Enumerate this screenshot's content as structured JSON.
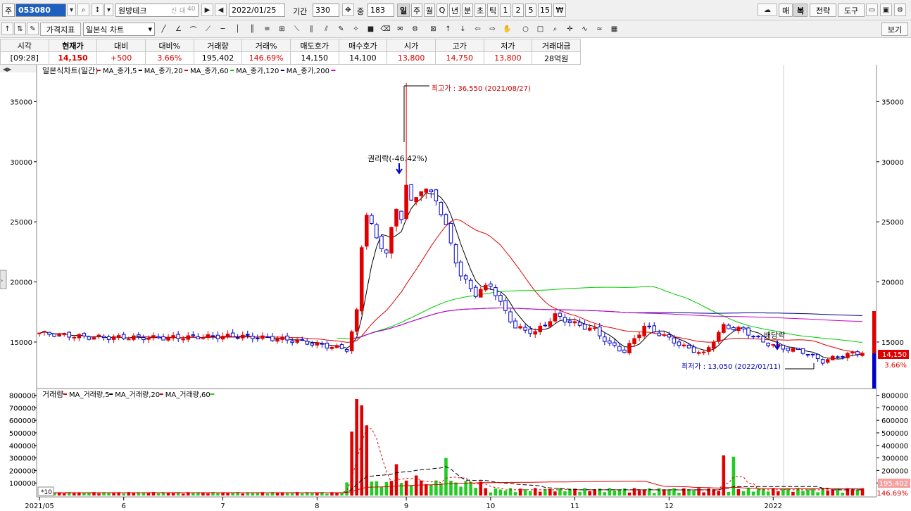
{
  "toolbar": {
    "market_btn": "주",
    "code": "053080",
    "stock_name": "원방테크",
    "date": "2022/01/25",
    "period_label": "기간",
    "period_value": "330",
    "overlap_label": "중",
    "overlap_value": "183",
    "tabs": [
      "일",
      "주",
      "월",
      "Q",
      "년",
      "분",
      "초",
      "틱",
      "1",
      "2",
      "5",
      "15",
      "₩"
    ],
    "right_buttons": [
      "매",
      "복",
      "전략",
      "도구"
    ],
    "indicator_btn": "가격지표",
    "chart_type": "일본식 차트",
    "view_btn": "보기",
    "badges": [
      "신",
      "대",
      "40"
    ]
  },
  "quote": {
    "headers": [
      "시각",
      "현재가",
      "대비",
      "대비%",
      "거래량",
      "거래%",
      "매도호가",
      "매수호가",
      "시가",
      "고가",
      "저가",
      "거래대금"
    ],
    "values": [
      "[09:28]",
      "14,150",
      "+500",
      "3.66%",
      "195,402",
      "146.69%",
      "14,150",
      "14,100",
      "13,800",
      "14,750",
      "13,800",
      "28억원"
    ]
  },
  "chart": {
    "price_title": "일본식차트(일간)",
    "price_legend": [
      {
        "label": "MA_종가,5",
        "color": "#e00000"
      },
      {
        "label": "MA_종가,20",
        "color": "#000000"
      },
      {
        "label": "MA_종가,60",
        "color": "#e00000"
      },
      {
        "label": "MA_종가,120",
        "color": "#00cc00"
      },
      {
        "label": "MA_종가,200",
        "color": "#00008b"
      }
    ],
    "volume_title": "거래량",
    "volume_legend": [
      {
        "label": "MA_거래량,5",
        "color": "#e00000"
      },
      {
        "label": "MA_거래량,20",
        "color": "#000000"
      },
      {
        "label": "MA_거래량,60",
        "color": "#e00000"
      }
    ],
    "annotations": {
      "high": "최고가 : 36,550 (2021/08/27)",
      "low": "최저가 : 13,050 (2022/01/11)",
      "rights": "권리락(-46.42%)",
      "dividend": "배당락"
    },
    "last_price_tag": "14,150",
    "last_change_tag": "3.66%",
    "last_volume_tag": "195,402",
    "last_volume_pct_tag": "146.69%",
    "volume_unit": "*10"
  },
  "chart_data": {
    "type": "candlestick",
    "title": "일본식차트(일간)",
    "price_axis": {
      "ticks": [
        15000,
        20000,
        25000,
        30000,
        35000
      ],
      "range": [
        11600,
        37600
      ]
    },
    "volume_axis": {
      "ticks": [
        100000,
        200000,
        300000,
        400000,
        500000,
        600000,
        700000,
        800000
      ],
      "range": [
        0,
        820000
      ]
    },
    "x_labels": [
      "2021/05",
      "6",
      "7",
      "8",
      "9",
      "10",
      "11",
      "12",
      "2022"
    ],
    "x_label_days": [
      0,
      17,
      37,
      56,
      74,
      91,
      108,
      127,
      148
    ],
    "days_total": 166,
    "key_points": [
      {
        "day": 0,
        "close": 15750
      },
      {
        "day": 10,
        "close": 15400
      },
      {
        "day": 25,
        "close": 15350
      },
      {
        "day": 40,
        "close": 15500
      },
      {
        "day": 50,
        "close": 15200
      },
      {
        "day": 62,
        "close": 14400
      },
      {
        "day": 63,
        "close": 15800
      },
      {
        "day": 64,
        "close": 17500
      },
      {
        "day": 65,
        "close": 23000
      },
      {
        "day": 66,
        "close": 25800
      },
      {
        "day": 68,
        "close": 23500
      },
      {
        "day": 70,
        "close": 22500
      },
      {
        "day": 72,
        "close": 26000
      },
      {
        "day": 73,
        "close": 25500
      },
      {
        "day": 74,
        "close": 28000
      },
      {
        "day": 75,
        "close": 26500
      },
      {
        "day": 77,
        "close": 27800
      },
      {
        "day": 80,
        "close": 27000
      },
      {
        "day": 82,
        "close": 24500
      },
      {
        "day": 85,
        "close": 20500
      },
      {
        "day": 88,
        "close": 19000
      },
      {
        "day": 91,
        "close": 19800
      },
      {
        "day": 93,
        "close": 18200
      },
      {
        "day": 96,
        "close": 16200
      },
      {
        "day": 100,
        "close": 15800
      },
      {
        "day": 104,
        "close": 17200
      },
      {
        "day": 108,
        "close": 16500
      },
      {
        "day": 112,
        "close": 16000
      },
      {
        "day": 115,
        "close": 14800
      },
      {
        "day": 118,
        "close": 14200
      },
      {
        "day": 122,
        "close": 16300
      },
      {
        "day": 126,
        "close": 15500
      },
      {
        "day": 130,
        "close": 14600
      },
      {
        "day": 134,
        "close": 14000
      },
      {
        "day": 138,
        "close": 16300
      },
      {
        "day": 142,
        "close": 16000
      },
      {
        "day": 146,
        "close": 15000
      },
      {
        "day": 150,
        "close": 14500
      },
      {
        "day": 154,
        "close": 14200
      },
      {
        "day": 158,
        "close": 13400
      },
      {
        "day": 162,
        "close": 13900
      },
      {
        "day": 166,
        "close": 14150
      }
    ],
    "high": {
      "day": 74,
      "value": 36550,
      "date": "2021/08/27"
    },
    "low": {
      "day": 158,
      "value": 13050,
      "date": "2022/01/11"
    },
    "volume_spikes": [
      {
        "day": 63,
        "value": 510000
      },
      {
        "day": 64,
        "value": 770000
      },
      {
        "day": 65,
        "value": 720000
      },
      {
        "day": 66,
        "value": 560000
      },
      {
        "day": 72,
        "value": 250000
      },
      {
        "day": 76,
        "value": 160000
      },
      {
        "day": 82,
        "value": 300000
      },
      {
        "day": 138,
        "value": 320000
      },
      {
        "day": 140,
        "value": 310000
      }
    ],
    "series": [
      {
        "name": "MA_종가,5",
        "color": "#000000"
      },
      {
        "name": "MA_종가,20",
        "color": "#e00000"
      },
      {
        "name": "MA_종가,60",
        "color": "#00cc00"
      },
      {
        "name": "MA_종가,120",
        "color": "#00008b"
      },
      {
        "name": "MA_종가,200",
        "color": "#cc00cc"
      }
    ]
  }
}
